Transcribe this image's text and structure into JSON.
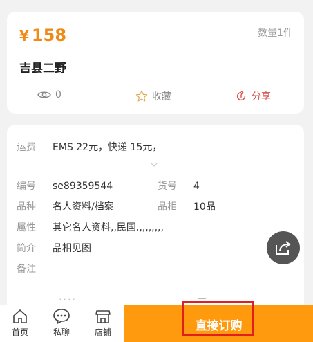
{
  "product": {
    "currency": "¥",
    "price": "158",
    "quantity": "数量1件",
    "title": "吉县二野"
  },
  "stats": {
    "views": "0",
    "favorite_label": "收藏",
    "share_label": "分享"
  },
  "details": {
    "shipping_label": "运费",
    "shipping_value": "EMS 22元，快递 15元，",
    "code_label": "编号",
    "code_value": "se89359544",
    "item_no_label": "货号",
    "item_no_value": "4",
    "category_label": "品种",
    "category_value": "名人资料/档案",
    "condition_label": "品相",
    "condition_value": "10品",
    "attributes_label": "属性",
    "attributes_value": "其它名人资料,,民国,,,,,,,,,",
    "intro_label": "简介",
    "intro_value": "品相见图",
    "note_label": "备注",
    "note_value": ""
  },
  "bottom_bar": {
    "home": "首页",
    "chat": "私聊",
    "shop": "店铺",
    "buy": "直接订购"
  },
  "colors": {
    "accent": "#f08a17",
    "buy_button": "#ff9a0e",
    "share": "#d9534f",
    "highlight": "#e02020"
  }
}
